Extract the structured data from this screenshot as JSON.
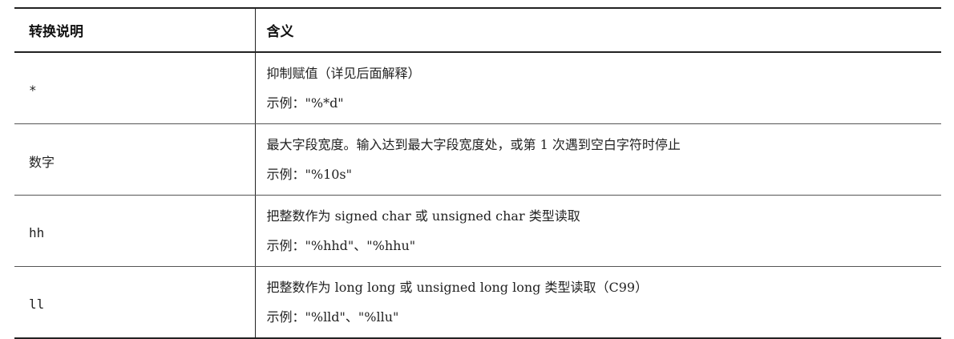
{
  "table": {
    "headers": [
      "转换说明",
      "含义"
    ],
    "rows": [
      {
        "specifier": "*",
        "meaning": "抑制赋值（详见后面解释）",
        "example": "示例：\"%*d\""
      },
      {
        "specifier": "数字",
        "meaning": "最大字段宽度。输入达到最大字段宽度处，或第 1 次遇到空白字符时停止",
        "example": "示例：\"%10s\""
      },
      {
        "specifier": "hh",
        "meaning": "把整数作为 signed char 或 unsigned char 类型读取",
        "example": "示例：\"%hhd\"、\"%hhu\""
      },
      {
        "specifier": "ll",
        "meaning": "把整数作为 long long 或 unsigned long long 类型读取（C99）",
        "example": "示例：\"%lld\"、\"%llu\""
      }
    ]
  }
}
